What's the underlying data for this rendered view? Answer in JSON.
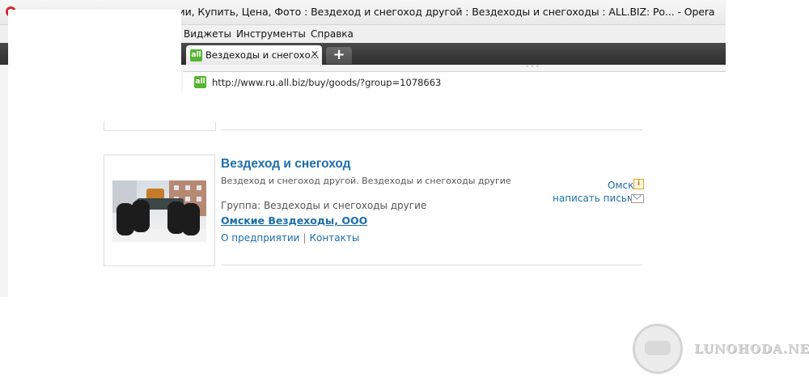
{
  "window": {
    "title": "Вездеходы и снегоходы в России, Купить, Цена, Фото : Вездеход и снегоход другой : Вездеходы и снегоходы : ALL.BIZ: Ро... - Opera",
    "title_visible": "ссии, Купить, Цена, Фото : Вездеход и снегоход другой : Вездеходы и снегоходы : ALL.BIZ: Ро... - Opera"
  },
  "menu": {
    "items": [
      "Виджеты",
      "Инструменты",
      "Справка"
    ]
  },
  "tabs": [
    {
      "label": "Вездеходы и снегохо...",
      "favicon": "all"
    }
  ],
  "new_tab_symbol": "+",
  "close_symbol": "✕",
  "address": {
    "favicon": "all",
    "url": "http://www.ru.all.biz/buy/goods/?group=1078663"
  },
  "listing": {
    "title": "Вездеход и снегоход",
    "description": "Вездеход и снегоход другой. Вездеходы и снегоходы другие",
    "group": "Группа: Вездеходы и снегоходы другие",
    "company": "Омские Вездеходы, ООО",
    "links": [
      "О предприятии",
      "Контакты"
    ],
    "link_separator": "|",
    "city": "Омск",
    "info_symbol": "i",
    "write_label": "написать письмо"
  },
  "watermark": {
    "text": "LUNOHODA.NET"
  },
  "colors": {
    "link": "#1c6eaa",
    "favicon": "#56b531",
    "opera_red": "#d3262b"
  }
}
